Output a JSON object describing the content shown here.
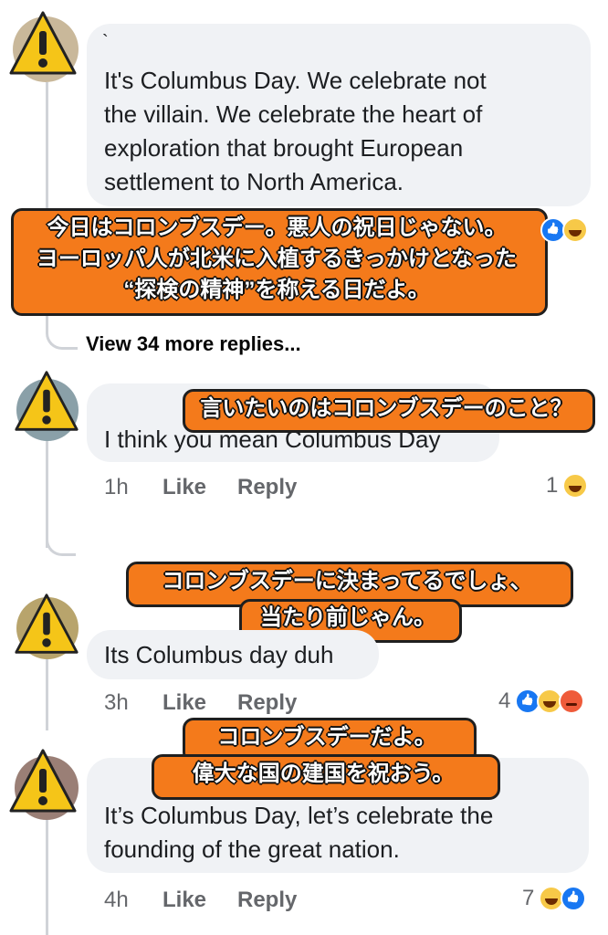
{
  "comments": [
    {
      "id": "c1",
      "text_lines": [
        "It's Columbus Day. We celebrate not",
        "the villain. We celebrate the heart of",
        "exploration that brought European",
        "settlement to North America."
      ],
      "author_mark": "`",
      "reactions": {
        "count": "",
        "icons": [
          "like-icon",
          "haha-icon"
        ]
      },
      "translation_lines": [
        "今日はコロンブスデー。悪人の祝日じゃない。",
        "ヨーロッパ人が北米に入植するきっかけとなった",
        "“探検の精神”を称える日だよ。"
      ]
    },
    {
      "id": "c2",
      "text_lines": [
        "I think you mean Columbus Day"
      ],
      "time": "1h",
      "like": "Like",
      "reply": "Reply",
      "reactions": {
        "count": "1",
        "icons": [
          "haha-icon"
        ]
      },
      "translation_lines": [
        "言いたいのはコロンブスデーのこと？"
      ]
    },
    {
      "id": "c3",
      "text_lines": [
        "Its Columbus day duh"
      ],
      "time": "3h",
      "like": "Like",
      "reply": "Reply",
      "reactions": {
        "count": "4",
        "icons": [
          "like-icon",
          "haha-icon",
          "angry-icon"
        ]
      },
      "translation_lines": [
        "コロンブスデーに決まってるでしょ、",
        "当たり前じゃん。"
      ]
    },
    {
      "id": "c4",
      "text_lines": [
        "It’s Columbus Day, let’s celebrate the",
        "founding of the great nation."
      ],
      "time": "4h",
      "like": "Like",
      "reply": "Reply",
      "reactions": {
        "count": "7",
        "icons": [
          "haha-icon",
          "like-icon"
        ]
      },
      "translation_lines": [
        "コロンブスデーだよ。",
        "偉大な国の建国を祝おう。"
      ]
    }
  ],
  "view_more": "View 34 more replies...",
  "colors": {
    "sticker": "#f47a1b",
    "bubble": "#f0f2f5",
    "like": "#1877f2",
    "haha": "#f7c948",
    "angry": "#ef5b3a",
    "warning": "#f5c518"
  }
}
